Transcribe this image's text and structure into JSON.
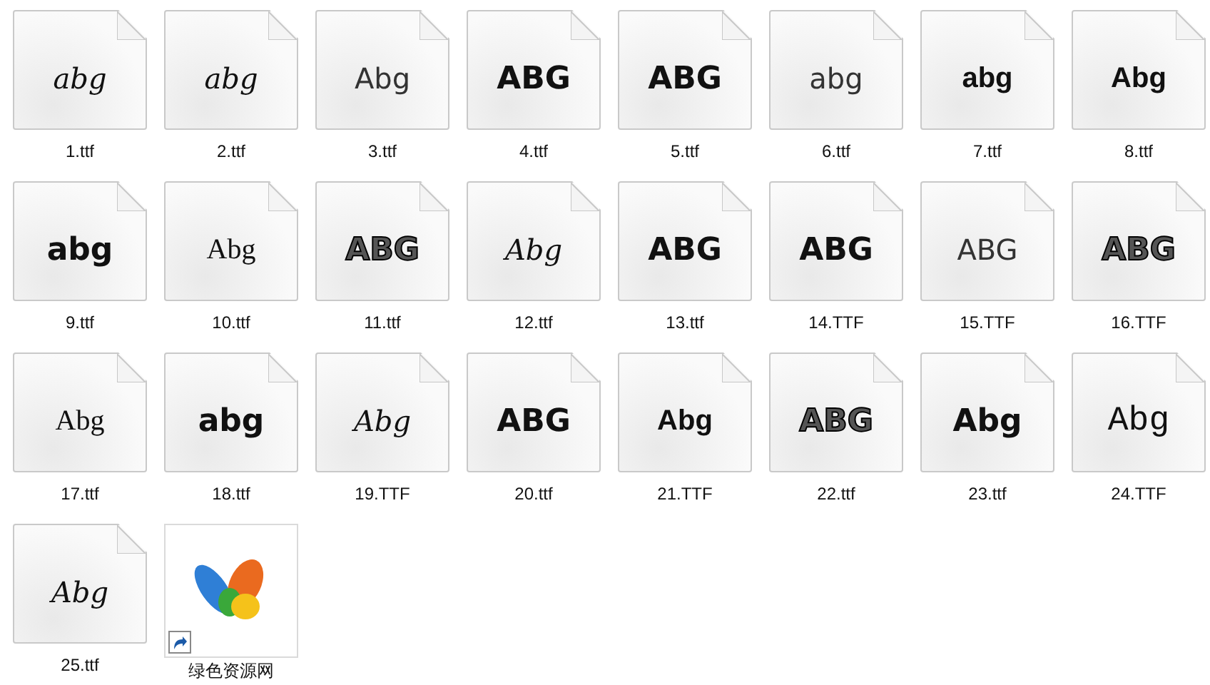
{
  "files": [
    {
      "kind": "font",
      "name": "1.ttf",
      "preview": "abg"
    },
    {
      "kind": "font",
      "name": "2.ttf",
      "preview": "abg"
    },
    {
      "kind": "font",
      "name": "3.ttf",
      "preview": "Abg"
    },
    {
      "kind": "font",
      "name": "4.ttf",
      "preview": "ABG"
    },
    {
      "kind": "font",
      "name": "5.ttf",
      "preview": "ABG"
    },
    {
      "kind": "font",
      "name": "6.ttf",
      "preview": "abg"
    },
    {
      "kind": "font",
      "name": "7.ttf",
      "preview": "abg"
    },
    {
      "kind": "font",
      "name": "8.ttf",
      "preview": "Abg"
    },
    {
      "kind": "font",
      "name": "9.ttf",
      "preview": "abg"
    },
    {
      "kind": "font",
      "name": "10.ttf",
      "preview": "Abg"
    },
    {
      "kind": "font",
      "name": "11.ttf",
      "preview": "ABG"
    },
    {
      "kind": "font",
      "name": "12.ttf",
      "preview": "Abg"
    },
    {
      "kind": "font",
      "name": "13.ttf",
      "preview": "ABG"
    },
    {
      "kind": "font",
      "name": "14.TTF",
      "preview": "ABG"
    },
    {
      "kind": "font",
      "name": "15.TTF",
      "preview": "ABG"
    },
    {
      "kind": "font",
      "name": "16.TTF",
      "preview": "ABG"
    },
    {
      "kind": "font",
      "name": "17.ttf",
      "preview": "Abg"
    },
    {
      "kind": "font",
      "name": "18.ttf",
      "preview": "abg"
    },
    {
      "kind": "font",
      "name": "19.TTF",
      "preview": "Abg"
    },
    {
      "kind": "font",
      "name": "20.ttf",
      "preview": "ABG"
    },
    {
      "kind": "font",
      "name": "21.TTF",
      "preview": "Abg"
    },
    {
      "kind": "font",
      "name": "22.ttf",
      "preview": "ABG"
    },
    {
      "kind": "font",
      "name": "23.ttf",
      "preview": "Abg"
    },
    {
      "kind": "font",
      "name": "24.TTF",
      "preview": "Abg"
    },
    {
      "kind": "font",
      "name": "25.ttf",
      "preview": "Abg"
    },
    {
      "kind": "shortcut",
      "name": "绿色资源网"
    }
  ]
}
